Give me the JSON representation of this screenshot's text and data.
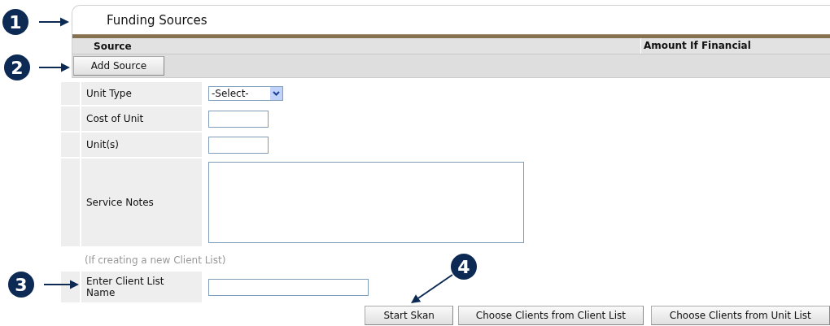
{
  "panel": {
    "title": "Funding Sources",
    "columns": [
      "Source",
      "Amount If Financial"
    ],
    "add_button": "Add Source"
  },
  "form": {
    "rows": [
      {
        "label": "Unit Type",
        "kind": "select",
        "value": "-Select-"
      },
      {
        "label": "Cost of Unit",
        "kind": "text"
      },
      {
        "label": "Unit(s)",
        "kind": "text"
      },
      {
        "label": "Service Notes",
        "kind": "textarea"
      }
    ],
    "hint": "(If creating a new Client List)",
    "client_list_label": "Enter Client List Name"
  },
  "buttons": [
    "Start Skan",
    "Choose Clients from Client List",
    "Choose Clients from Unit List"
  ],
  "callouts": [
    "1",
    "2",
    "3",
    "4"
  ]
}
